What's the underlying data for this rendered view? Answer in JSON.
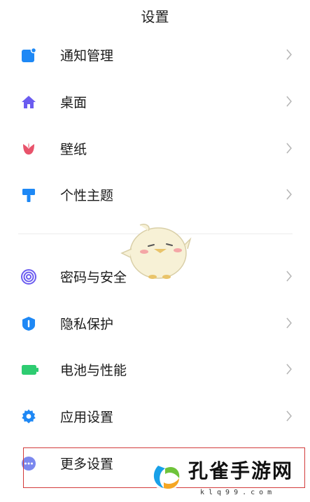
{
  "header": {
    "title": "设置"
  },
  "items": [
    {
      "label": "通知管理",
      "icon": "notification-icon",
      "color": "#1e88f5"
    },
    {
      "label": "桌面",
      "icon": "home-icon",
      "color": "#6b5cf0"
    },
    {
      "label": "壁纸",
      "icon": "wallpaper-icon",
      "color": "#e8536b"
    },
    {
      "label": "个性主题",
      "icon": "theme-brush-icon",
      "color": "#1e88f5"
    },
    {
      "label": "密码与安全",
      "icon": "fingerprint-icon",
      "color": "#6b5cf0"
    },
    {
      "label": "隐私保护",
      "icon": "privacy-shield-icon",
      "color": "#1e88f5"
    },
    {
      "label": "电池与性能",
      "icon": "battery-icon",
      "color": "#2ecc71"
    },
    {
      "label": "应用设置",
      "icon": "gear-icon",
      "color": "#1e88f5"
    },
    {
      "label": "更多设置",
      "icon": "more-icon",
      "color": "#6b7cf0"
    }
  ],
  "watermark": {
    "text": "孔雀手游网",
    "url": "klq99.com"
  },
  "colors": {
    "highlight": "#d23b3b",
    "chevron": "#b5b5b5"
  }
}
